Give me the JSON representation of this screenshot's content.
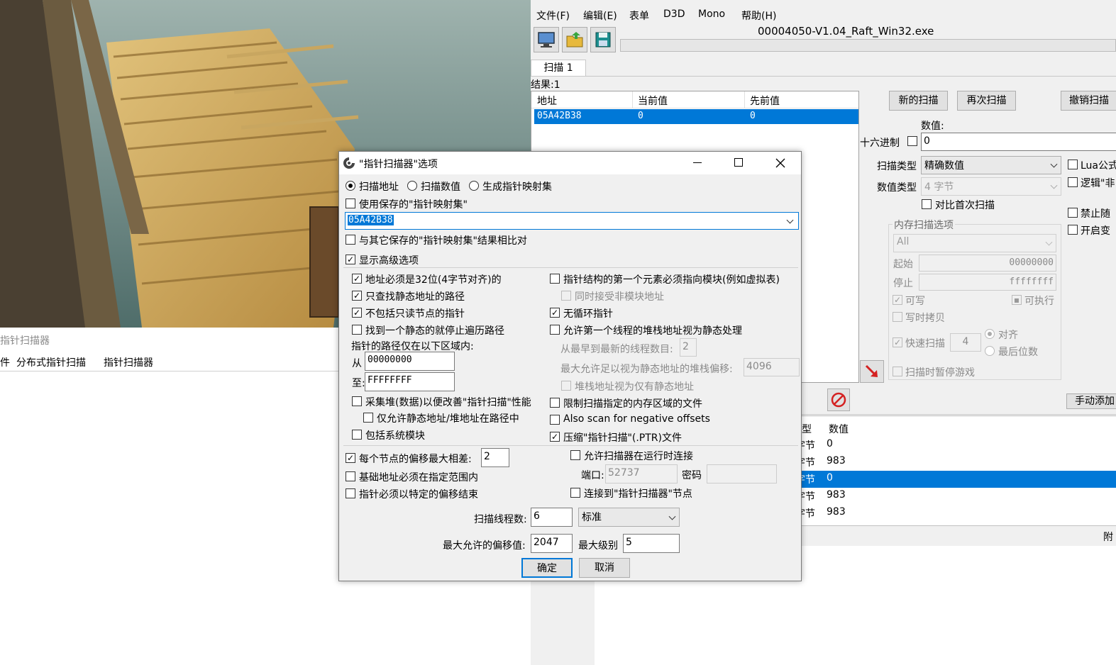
{
  "game": {
    "window_title": "指针扫描器",
    "menu": [
      "件",
      "分布式指针扫描",
      "指针扫描器"
    ]
  },
  "ce": {
    "menu": [
      "文件(F)",
      "编辑(E)",
      "表单",
      "D3D",
      "Mono",
      "帮助(H)"
    ],
    "process_title": "00004050-V1.04_Raft_Win32.exe",
    "tab": "扫描 1",
    "results_label": "结果:1",
    "columns": [
      "地址",
      "当前值",
      "先前值"
    ],
    "result_row": {
      "address": "05A42B38",
      "current": "0",
      "previous": "0"
    },
    "buttons": {
      "new_scan": "新的扫描",
      "next_scan": "再次扫描",
      "undo_scan": "撤销扫描",
      "add_manual": "手动添加"
    },
    "value_label": "数值:",
    "hex_label": "十六进制",
    "value": "0",
    "scan_type_label": "扫描类型",
    "scan_type": "精确数值",
    "value_type_label": "数值类型",
    "value_type": "4 字节",
    "compare_first": "对比首次扫描",
    "lua_formula": "Lua公式",
    "logic_not": "逻辑\"非",
    "disable_random": "禁止随",
    "enable_speedhack": "开启变",
    "mem_group": "内存扫描选项",
    "mem_region": "All",
    "start_label": "起始",
    "start_value": "00000000",
    "stop_label": "停止",
    "stop_value": "ffffffff",
    "writable": "可写",
    "executable": "可执行",
    "copy_on_write": "写时拷贝",
    "fast_scan": "快速扫描",
    "fast_scan_value": "4",
    "align": "对齐",
    "last_digits": "最后位数",
    "pause_game": "扫描时暂停游戏",
    "table_header_type": "型",
    "table_header_value": "数值",
    "table_rows": [
      {
        "type": "字节",
        "value": "0"
      },
      {
        "type": "字节",
        "value": "983"
      },
      {
        "type": "字节",
        "value": "0"
      },
      {
        "type": "字节",
        "value": "983"
      },
      {
        "type": "字节",
        "value": "983"
      }
    ],
    "footer_right": "附"
  },
  "dialog": {
    "title": "\"指针扫描器\"选项",
    "radio_scan_address": "扫描地址",
    "radio_scan_value": "扫描数值",
    "radio_gen_map": "生成指针映射集",
    "use_saved_map": "使用保存的\"指针映射集\"",
    "address_value": "05A42B38",
    "compare_saved": "与其它保存的\"指针映射集\"结果相比对",
    "show_advanced": "显示高级选项",
    "opt_aligned": "地址必须是32位(4字节对齐)的",
    "opt_static_only": "只查找静态地址的路径",
    "opt_no_readonly": "不包括只读节点的指针",
    "opt_stop_first_static": "找到一个静态的就停止遍历路径",
    "path_region_label": "指针的路径仅在以下区域内:",
    "from_label": "从",
    "from_value": "00000000",
    "to_label": "至:",
    "to_value": "FFFFFFFF",
    "opt_collect_heap": "采集堆(数据)以便改善\"指针扫描\"性能",
    "opt_only_static_heap": "仅允许静态地址/堆地址在路径中",
    "opt_include_system": "包括系统模块",
    "opt_first_element_module": "指针结构的第一个元素必须指向模块(例如虚拟表)",
    "opt_accept_nonmodule": "同时接受非模块地址",
    "opt_no_loop": "无循环指针",
    "opt_thread_stack": "允许第一个线程的堆栈地址视为静态处理",
    "thread_count_label": "从最早到最新的线程数目:",
    "thread_count_value": "2",
    "stack_offset_label": "最大允许足以视为静态地址的堆栈偏移:",
    "stack_offset_value": "4096",
    "opt_stack_only_static": "堆栈地址视为仅有静态地址",
    "opt_limit_regions": "限制扫描指定的内存区域的文件",
    "opt_negative_offsets": "Also scan for negative offsets",
    "opt_compress": "压缩\"指针扫描\"(.PTR)文件",
    "opt_max_diff": "每个节点的偏移最大相差:",
    "max_diff_value": "2",
    "opt_base_range": "基础地址必须在指定范围内",
    "opt_end_offsets": "指针必须以特定的偏移结束",
    "opt_allow_connect": "允许扫描器在运行时连接",
    "port_label": "端口:",
    "port_value": "52737",
    "password_label": "密码",
    "opt_connect_node": "连接到\"指针扫描器\"节点",
    "threads_label": "扫描线程数:",
    "threads_value": "6",
    "priority": "标准",
    "max_offset_label": "最大允许的偏移值:",
    "max_offset_value": "2047",
    "max_level_label": "最大级别",
    "max_level_value": "5",
    "ok": "确定",
    "cancel": "取消"
  },
  "colors": {
    "selection": "#0078d7",
    "dialog_bg": "#f0f0f0"
  }
}
